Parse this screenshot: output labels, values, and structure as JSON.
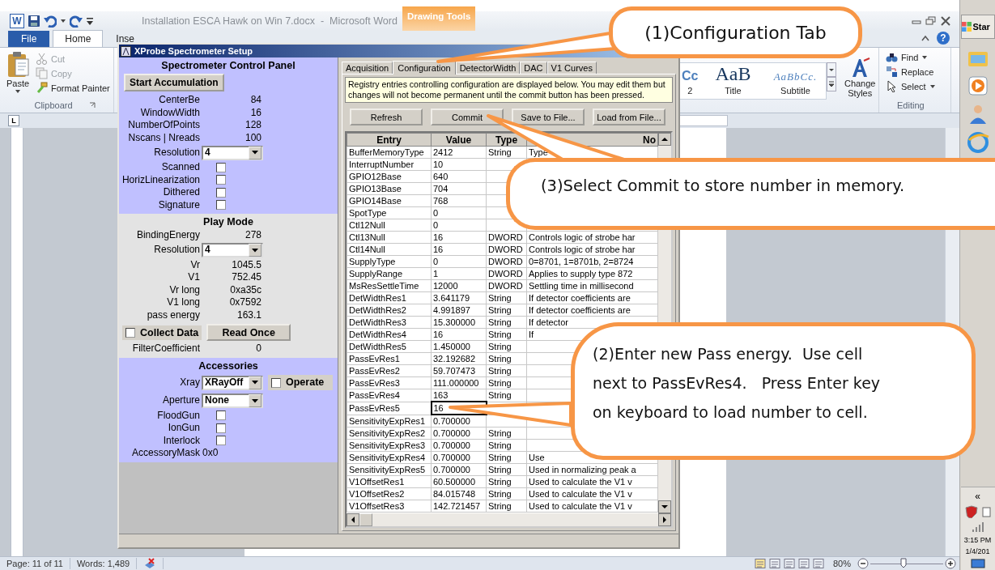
{
  "word": {
    "logo": "W",
    "title": "Installation ESCA Hawk on Win 7.docx  -  Microsoft Word",
    "contextual_tab": "Drawing Tools",
    "tabs": [
      {
        "label": "File",
        "kind": "file",
        "selected": false
      },
      {
        "label": "Home",
        "kind": "tab",
        "selected": true
      },
      {
        "label": "Inse",
        "kind": "tab",
        "selected": false
      }
    ],
    "clipboard": {
      "paste": "Paste",
      "items": [
        {
          "label": "Cut",
          "disabled": true
        },
        {
          "label": "Copy",
          "disabled": true
        },
        {
          "label": "Format Painter",
          "disabled": false
        }
      ],
      "group": "Clipboard"
    },
    "styles": [
      {
        "sample": "Cc",
        "label": "2",
        "kind": "heading"
      },
      {
        "sample": "AaB",
        "label": "Title",
        "kind": "title"
      },
      {
        "sample": "AaBbCc.",
        "label": "Subtitle",
        "kind": "subtitle"
      }
    ],
    "change_styles": "Change Styles",
    "editing": {
      "items": [
        {
          "label": "Find",
          "dropdown": true
        },
        {
          "label": "Replace",
          "dropdown": false
        },
        {
          "label": "Select",
          "dropdown": true
        }
      ],
      "group": "Editing"
    },
    "help": "?",
    "tab_selector": "L",
    "status_bar": {
      "page": "Page: 11 of 11",
      "words": "Words: 1,489",
      "zoom": "80%",
      "zoom_slider": {
        "level": 0.45
      }
    }
  },
  "taskbar": {
    "start": "Star",
    "expand": "«",
    "time": "3:15 PM",
    "date": "1/4/201"
  },
  "dialog": {
    "title": "XProbe Spectrometer Setup",
    "control_panel": {
      "heading": "Spectrometer Control Panel",
      "start_button": "Start Accumulation",
      "readings": [
        {
          "label": "CenterBe",
          "value": "84"
        },
        {
          "label": "WindowWidth",
          "value": "16"
        },
        {
          "label": "NumberOfPoints",
          "value": "128"
        },
        {
          "label": "Nscans | Nreads",
          "value": "100"
        }
      ],
      "resolution": {
        "label": "Resolution",
        "value": "4"
      },
      "options": [
        {
          "label": "Scanned",
          "checked": false
        },
        {
          "label": "HorizLinearization",
          "checked": false
        },
        {
          "label": "Dithered",
          "checked": false
        },
        {
          "label": "Signature",
          "checked": false
        }
      ]
    },
    "play_mode": {
      "heading": "Play Mode",
      "binding_energy": {
        "label": "BindingEnergy",
        "value": "278"
      },
      "resolution": {
        "label": "Resolution",
        "value": "4"
      },
      "readings": [
        {
          "label": "Vr",
          "value": "1045.5"
        },
        {
          "label": "V1",
          "value": "752.45"
        },
        {
          "label": "Vr long",
          "value": "0xa35c"
        },
        {
          "label": "V1 long",
          "value": "0x7592"
        },
        {
          "label": "pass energy",
          "value": "163.1"
        }
      ],
      "collect_data": {
        "label": "Collect Data",
        "checked": false
      },
      "read_once": "Read Once",
      "filter": {
        "label": "FilterCoefficient",
        "value": "0"
      }
    },
    "accessories": {
      "heading": "Accessories",
      "xray": {
        "label": "Xray",
        "value": "XRayOff"
      },
      "operate": {
        "label": "Operate",
        "checked": false
      },
      "aperture": {
        "label": "Aperture",
        "value": "None"
      },
      "options": [
        {
          "label": "FloodGun",
          "checked": false
        },
        {
          "label": "IonGun",
          "checked": false
        },
        {
          "label": "Interlock",
          "checked": false
        }
      ],
      "mask": {
        "label": "AccessoryMask",
        "value": "0x0"
      }
    },
    "tabs": [
      {
        "label": "Acquisition",
        "selected": false
      },
      {
        "label": "Configuration",
        "selected": true
      },
      {
        "label": "DetectorWidth",
        "selected": false
      },
      {
        "label": "DAC",
        "selected": false
      },
      {
        "label": "V1 Curves",
        "selected": false
      }
    ],
    "info": "Registry entries controlling configuration are displayed below. You may edit them but changes will not become permanent until the commit button has been pressed.",
    "buttons": [
      "Refresh",
      "Commit",
      "Save to File...",
      "Load from File..."
    ],
    "table": {
      "columns": [
        "Entry",
        "Value",
        "Type",
        "No"
      ],
      "rows": [
        {
          "entry": "BufferMemoryType",
          "value": "2412",
          "type": "String",
          "notes": "Type",
          "editing": false
        },
        {
          "entry": "InterruptNumber",
          "value": "10",
          "editing": false
        },
        {
          "entry": "GPIO12Base",
          "value": "640",
          "editing": false
        },
        {
          "entry": "GPIO13Base",
          "value": "704",
          "editing": false
        },
        {
          "entry": "GPIO14Base",
          "value": "768",
          "editing": false
        },
        {
          "entry": "SpotType",
          "value": "0",
          "editing": false
        },
        {
          "entry": "Ctl12Null",
          "value": "0",
          "editing": false
        },
        {
          "entry": "Ctl13Null",
          "value": "16",
          "type": "DWORD",
          "notes": "Controls logic of strobe har",
          "editing": false
        },
        {
          "entry": "Ctl14Null",
          "value": "16",
          "type": "DWORD",
          "notes": "Controls logic of strobe har",
          "editing": false
        },
        {
          "entry": "SupplyType",
          "value": "0",
          "type": "DWORD",
          "notes": "0=8701, 1=8701b, 2=8724",
          "editing": false
        },
        {
          "entry": "SupplyRange",
          "value": "1",
          "type": "DWORD",
          "notes": "Applies to supply type 872",
          "editing": false
        },
        {
          "entry": "MsResSettleTime",
          "value": "12000",
          "type": "DWORD",
          "notes": "Settling time in millisecond",
          "editing": false
        },
        {
          "entry": "DetWidthRes1",
          "value": "3.641179",
          "type": "String",
          "notes": "If detector coefficients are",
          "editing": false
        },
        {
          "entry": "DetWidthRes2",
          "value": "4.991897",
          "type": "String",
          "notes": "If detector coefficients are",
          "editing": false
        },
        {
          "entry": "DetWidthRes3",
          "value": "15.300000",
          "type": "String",
          "notes": "If detector",
          "editing": false
        },
        {
          "entry": "DetWidthRes4",
          "value": "16",
          "type": "String",
          "notes": "If",
          "editing": false
        },
        {
          "entry": "DetWidthRes5",
          "value": "1.450000",
          "type": "String",
          "editing": false
        },
        {
          "entry": "PassEvRes1",
          "value": "32.192682",
          "type": "String",
          "editing": false
        },
        {
          "entry": "PassEvRes2",
          "value": "59.707473",
          "type": "String",
          "editing": false
        },
        {
          "entry": "PassEvRes3",
          "value": "111.000000",
          "type": "String",
          "editing": false
        },
        {
          "entry": "PassEvRes4",
          "value": "163",
          "type": "String",
          "editing": false
        },
        {
          "entry": "PassEvRes5",
          "value": "16",
          "editing": true
        },
        {
          "entry": "SensitivityExpRes1",
          "value": "0.700000",
          "editing": false
        },
        {
          "entry": "SensitivityExpRes2",
          "value": "0.700000",
          "type": "String",
          "editing": false
        },
        {
          "entry": "SensitivityExpRes3",
          "value": "0.700000",
          "type": "String",
          "editing": false
        },
        {
          "entry": "SensitivityExpRes4",
          "value": "0.700000",
          "type": "String",
          "notes": "Use",
          "editing": false
        },
        {
          "entry": "SensitivityExpRes5",
          "value": "0.700000",
          "type": "String",
          "notes": "Used in normalizing peak a",
          "editing": false
        },
        {
          "entry": "V1OffsetRes1",
          "value": "60.500000",
          "type": "String",
          "notes": "Used to calculate the V1 v",
          "editing": false
        },
        {
          "entry": "V1OffsetRes2",
          "value": "84.015748",
          "type": "String",
          "notes": "Used to calculate the V1 v",
          "editing": false
        },
        {
          "entry": "V1OffsetRes3",
          "value": "142.721457",
          "type": "String",
          "notes": "Used to calculate the V1 v",
          "editing": false
        }
      ]
    }
  },
  "callouts": [
    {
      "text": "(1)Configuration Tab"
    },
    {
      "text": "(3)Select Commit to store number in memory."
    },
    {
      "text": "(2)Enter new Pass energy.  Use cell\nnext to PassEvRes4.   Press Enter key\non keyboard to load number to cell."
    }
  ]
}
